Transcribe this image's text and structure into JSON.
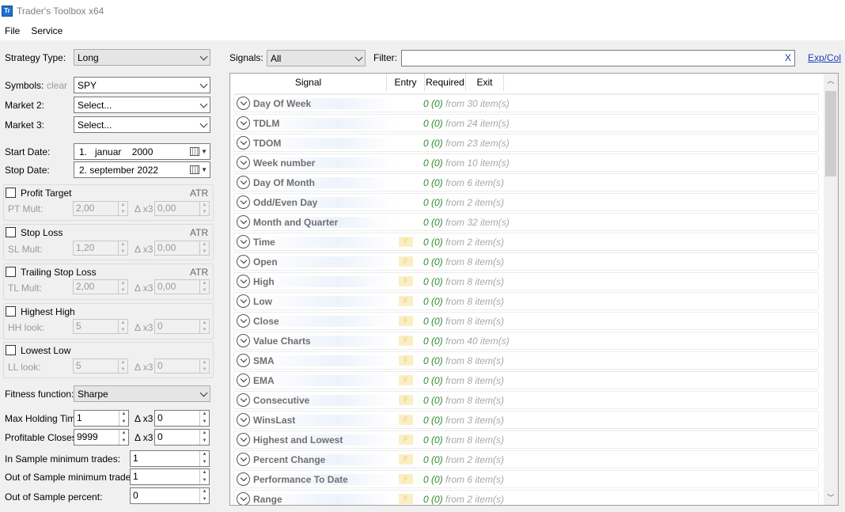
{
  "window": {
    "title": "Trader's Toolbox x64",
    "icon_text": "Tr"
  },
  "menu": [
    "File",
    "Service"
  ],
  "left": {
    "strategy_type_label": "Strategy Type:",
    "strategy_type_value": "Long",
    "symbols_label": "Symbols:",
    "symbols_clear": "clear",
    "symbols_value": "SPY",
    "market2_label": "Market 2:",
    "market2_value": "Select...",
    "market3_label": "Market 3:",
    "market3_value": "Select...",
    "start_date_label": "Start Date:",
    "start_date_value": "1.   januar    2000",
    "stop_date_label": "Stop Date:",
    "stop_date_value": "2. september 2022",
    "atr": "ATR",
    "delta": "Δ x3",
    "groups": [
      {
        "title": "Profit Target",
        "field": "PT Mult:",
        "value": "2,00",
        "delta_value": "0,00",
        "atr": true
      },
      {
        "title": "Stop Loss",
        "field": "SL Mult:",
        "value": "1,20",
        "delta_value": "0,00",
        "atr": true
      },
      {
        "title": "Trailing Stop Loss",
        "field": "TL Mult:",
        "value": "2,00",
        "delta_value": "0,00",
        "atr": true
      },
      {
        "title": "Highest High",
        "field": "HH look:",
        "value": "5",
        "delta_value": "0",
        "atr": false
      },
      {
        "title": "Lowest Low",
        "field": "LL look:",
        "value": "5",
        "delta_value": "0",
        "atr": false
      }
    ],
    "fitness_label": "Fitness function:",
    "fitness_value": "Sharpe",
    "max_holding_label": "Max Holding Time:",
    "max_holding_value": "1",
    "max_holding_delta": "0",
    "profitable_closes_label": "Profitable Closes:",
    "profitable_closes_value": "9999",
    "profitable_closes_delta": "0",
    "in_sample_label": "In Sample minimum trades:",
    "in_sample_value": "1",
    "out_sample_label": "Out of Sample minimum trades:",
    "out_sample_value": "1",
    "out_percent_label": "Out of Sample percent:",
    "out_percent_value": "0"
  },
  "right": {
    "signals_label": "Signals:",
    "signals_value": "All",
    "filter_label": "Filter:",
    "filter_value": "",
    "filter_clear": "X",
    "expcol": "Exp/Col",
    "columns": [
      "Signal",
      "Entry",
      "Required",
      "Exit"
    ],
    "badge_text": "F",
    "rows": [
      {
        "name": "Day Of Week",
        "count": "0 (0)",
        "from": "from 30 item(s)",
        "badge": false
      },
      {
        "name": "TDLM",
        "count": "0 (0)",
        "from": "from 24 item(s)",
        "badge": false
      },
      {
        "name": "TDOM",
        "count": "0 (0)",
        "from": "from 23 item(s)",
        "badge": false
      },
      {
        "name": "Week number",
        "count": "0 (0)",
        "from": "from 10 item(s)",
        "badge": false
      },
      {
        "name": "Day Of Month",
        "count": "0 (0)",
        "from": "from 6 item(s)",
        "badge": false
      },
      {
        "name": "Odd/Even Day",
        "count": "0 (0)",
        "from": "from 2 item(s)",
        "badge": false
      },
      {
        "name": "Month and Quarter",
        "count": "0 (0)",
        "from": "from 32 item(s)",
        "badge": false
      },
      {
        "name": "Time",
        "count": "0 (0)",
        "from": "from 2 item(s)",
        "badge": true
      },
      {
        "name": "Open",
        "count": "0 (0)",
        "from": "from 8 item(s)",
        "badge": true
      },
      {
        "name": "High",
        "count": "0 (0)",
        "from": "from 8 item(s)",
        "badge": true
      },
      {
        "name": "Low",
        "count": "0 (0)",
        "from": "from 8 item(s)",
        "badge": true
      },
      {
        "name": "Close",
        "count": "0 (0)",
        "from": "from 8 item(s)",
        "badge": true
      },
      {
        "name": "Value Charts",
        "count": "0 (0)",
        "from": "from 40 item(s)",
        "badge": true
      },
      {
        "name": "SMA",
        "count": "0 (0)",
        "from": "from 8 item(s)",
        "badge": true
      },
      {
        "name": "EMA",
        "count": "0 (0)",
        "from": "from 8 item(s)",
        "badge": true
      },
      {
        "name": "Consecutive",
        "count": "0 (0)",
        "from": "from 8 item(s)",
        "badge": true
      },
      {
        "name": "WinsLast",
        "count": "0 (0)",
        "from": "from 3 item(s)",
        "badge": true
      },
      {
        "name": "Highest and Lowest",
        "count": "0 (0)",
        "from": "from 8 item(s)",
        "badge": true
      },
      {
        "name": "Percent Change",
        "count": "0 (0)",
        "from": "from 2 item(s)",
        "badge": true
      },
      {
        "name": "Performance To Date",
        "count": "0 (0)",
        "from": "from 6 item(s)",
        "badge": true
      },
      {
        "name": "Range",
        "count": "0 (0)",
        "from": "from 2 item(s)",
        "badge": true
      }
    ]
  }
}
